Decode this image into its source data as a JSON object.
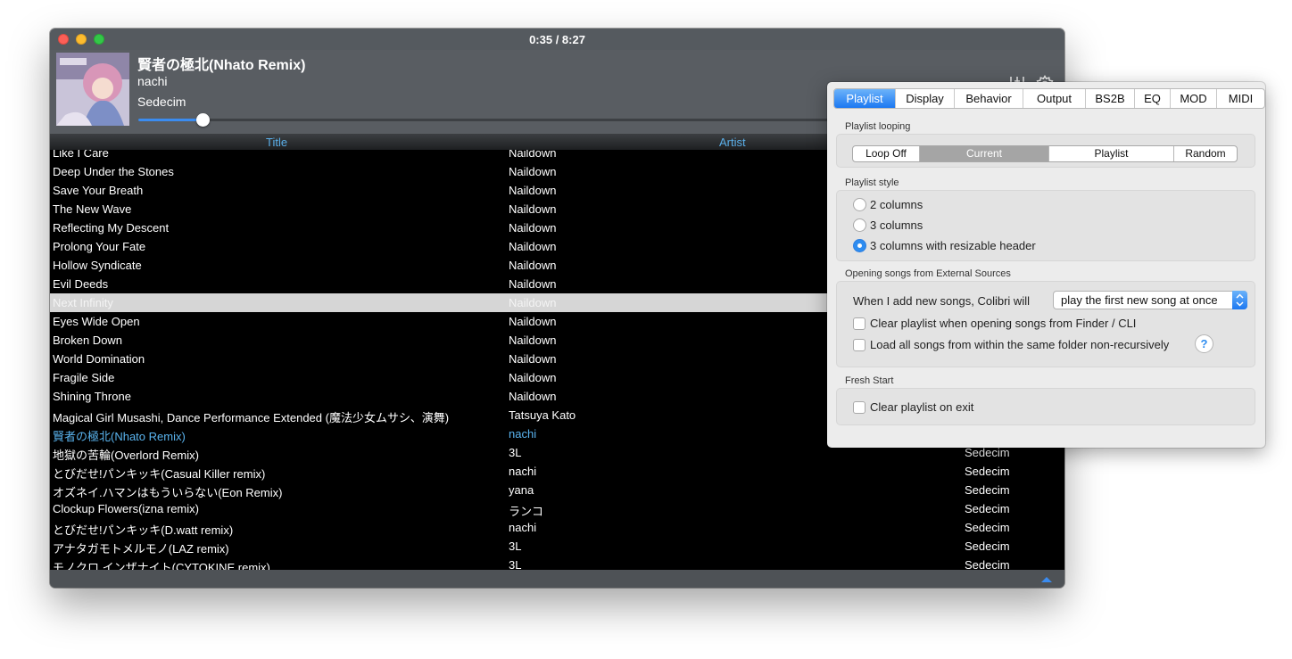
{
  "player": {
    "time": "0:35 / 8:27",
    "track_title": "賢者の極北(Nhato Remix)",
    "track_artist": "nachi",
    "track_album": "Sedecim",
    "progress_fraction": 0.0696,
    "accent_color": "#3b8cf0",
    "icons": [
      "equalizer-icon",
      "gear-icon"
    ]
  },
  "columns": {
    "title": "Title",
    "artist": "Artist"
  },
  "rows": [
    {
      "title": "Like I Care",
      "artist": "Naildown",
      "album": ""
    },
    {
      "title": "Deep Under the Stones",
      "artist": "Naildown",
      "album": ""
    },
    {
      "title": "Save Your Breath",
      "artist": "Naildown",
      "album": ""
    },
    {
      "title": "The New Wave",
      "artist": "Naildown",
      "album": ""
    },
    {
      "title": "Reflecting My Descent",
      "artist": "Naildown",
      "album": ""
    },
    {
      "title": "Prolong Your Fate",
      "artist": "Naildown",
      "album": ""
    },
    {
      "title": "Hollow Syndicate",
      "artist": "Naildown",
      "album": ""
    },
    {
      "title": "Evil Deeds",
      "artist": "Naildown",
      "album": ""
    },
    {
      "title": "Next Infinity",
      "artist": "Naildown",
      "album": ""
    },
    {
      "title": "Eyes Wide Open",
      "artist": "Naildown",
      "album": ""
    },
    {
      "title": "Broken Down",
      "artist": "Naildown",
      "album": ""
    },
    {
      "title": "World Domination",
      "artist": "Naildown",
      "album": ""
    },
    {
      "title": "Fragile Side",
      "artist": "Naildown",
      "album": ""
    },
    {
      "title": "Shining Throne",
      "artist": "Naildown",
      "album": ""
    },
    {
      "title": "Magical Girl Musashi, Dance Performance Extended (魔法少女ムサシ、演舞)",
      "artist": "Tatsuya Kato",
      "album": ""
    },
    {
      "title": "賢者の極北(Nhato Remix)",
      "artist": "nachi",
      "album": ""
    },
    {
      "title": "地獄の苦輪(Overlord Remix)",
      "artist": "3L",
      "album": "Sedecim"
    },
    {
      "title": "とびだせ!パンキッキ(Casual Killer remix)",
      "artist": "nachi",
      "album": "Sedecim"
    },
    {
      "title": "オズネイ.ハマンはもういらない(Eon Remix)",
      "artist": "yana",
      "album": "Sedecim"
    },
    {
      "title": "Clockup Flowers(izna remix)",
      "artist": "ランコ",
      "album": "Sedecim"
    },
    {
      "title": "とびだせ!パンキッキ(D.watt remix)",
      "artist": "nachi",
      "album": "Sedecim"
    },
    {
      "title": "アナタガモトメルモノ(LAZ remix)",
      "artist": "3L",
      "album": "Sedecim"
    },
    {
      "title": "モノクロ.インザナイト(CYTOKINE remix)",
      "artist": "3L",
      "album": "Sedecim"
    }
  ],
  "prefs": {
    "tabs": [
      {
        "label": "Playlist",
        "active": true
      },
      {
        "label": "Display",
        "active": false
      },
      {
        "label": "Behavior",
        "active": false
      },
      {
        "label": "Output",
        "active": false
      },
      {
        "label": "BS2B",
        "active": false
      },
      {
        "label": "EQ",
        "active": false
      },
      {
        "label": "MOD",
        "active": false
      },
      {
        "label": "MIDI",
        "active": false
      }
    ],
    "looping": {
      "label": "Playlist looping",
      "options": [
        "Loop Off",
        "Current",
        "Playlist",
        "Random"
      ],
      "selected": "Current"
    },
    "style": {
      "label": "Playlist style",
      "options": [
        "2 columns",
        "3 columns",
        "3 columns with resizable header"
      ],
      "selected": "3 columns with resizable header"
    },
    "external": {
      "label": "Opening songs from External Sources",
      "add_label": "When I add new songs, Colibri will",
      "add_value": "play the first new song at once",
      "clear_label": "Clear playlist when opening songs from Finder / CLI",
      "load_label": "Load all songs from within the same folder non-recursively",
      "help": "?"
    },
    "fresh": {
      "label": "Fresh Start",
      "clear_exit_label": "Clear playlist on exit"
    }
  }
}
